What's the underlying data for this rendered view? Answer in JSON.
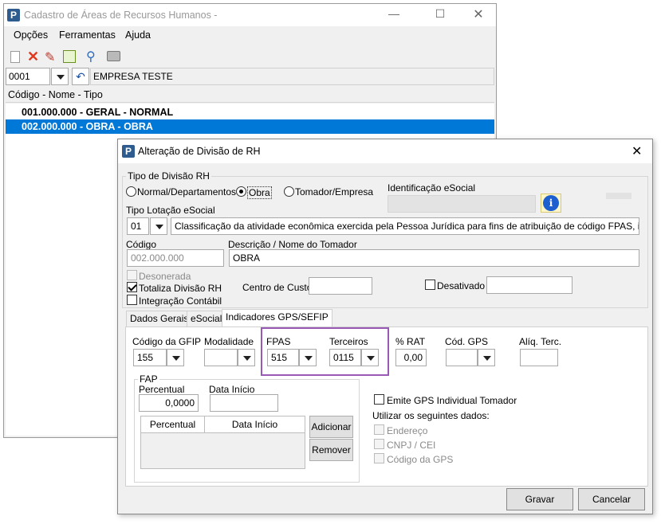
{
  "main_window": {
    "title": "Cadastro de Áreas de Recursos Humanos -",
    "menu": [
      "Opções",
      "Ferramentas",
      "Ajuda"
    ],
    "company_code": "0001",
    "company_name": "EMPRESA TESTE",
    "list_header": "Código - Nome - Tipo",
    "rows": [
      "001.000.000 - GERAL - NORMAL",
      "002.000.000 - OBRA - OBRA"
    ]
  },
  "dialog": {
    "title": "Alteração de Divisão de RH",
    "tipo_divisao_label": "Tipo de Divisão RH",
    "radio_normal": "Normal/Departamentos",
    "radio_obra": "Obra",
    "radio_tomador": "Tomador/Empresa",
    "identificacao_label": "Identificação eSocial",
    "tipo_lotacao_label": "Tipo Lotação eSocial",
    "tipo_lotacao_value": "01",
    "tipo_lotacao_desc": "Classificação da atividade econômica exercida pela Pessoa Jurídica para fins de atribuição de código FPAS, inclusive obras",
    "codigo_label": "Código",
    "codigo_value": "002.000.000",
    "descricao_label": "Descrição / Nome do Tomador",
    "descricao_value": "OBRA",
    "desonerada": "Desonerada",
    "totaliza": "Totaliza Divisão RH",
    "integracao": "Integração Contábil",
    "centro_custo": "Centro de Custo",
    "desativado": "Desativado",
    "tabs": [
      "Dados Gerais",
      "eSocial",
      "Indicadores GPS/SEFIP"
    ],
    "codigo_gfip_label": "Código da GFIP",
    "codigo_gfip_value": "155",
    "modalidade_label": "Modalidade",
    "fpas_label": "FPAS",
    "fpas_value": "515",
    "terceiros_label": "Terceiros",
    "terceiros_value": "0115",
    "rat_label": "% RAT",
    "rat_value": "0,00",
    "cod_gps_label": "Cód. GPS",
    "aliq_terc_label": "Alíq. Terc.",
    "fap_label": "FAP",
    "percentual_label": "Percentual",
    "percentual_value": "0,0000",
    "data_inicio_label": "Data Início",
    "grid_headers": [
      "Percentual",
      "Data Início"
    ],
    "adicionar": "Adicionar",
    "remover": "Remover",
    "emite_gps": "Emite GPS Individual Tomador",
    "utilizar": "Utilizar os seguintes dados:",
    "endereco": "Endereço",
    "cnpj": "CNPJ / CEI",
    "codigo_gps": "Código da GPS",
    "gravar": "Gravar",
    "cancelar": "Cancelar"
  },
  "colors": {
    "selection": "#0078d7",
    "highlight_box": "#9b59b6"
  }
}
